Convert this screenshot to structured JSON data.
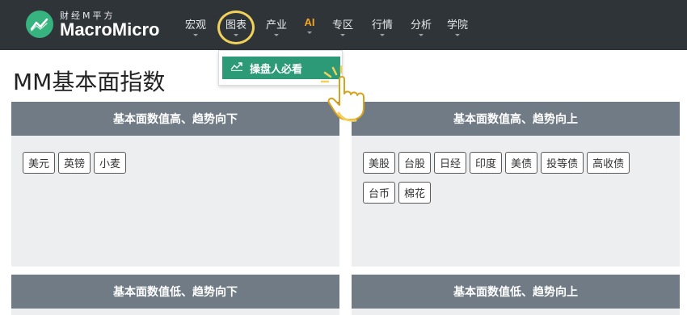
{
  "nav": {
    "logo_small": "财经M平方",
    "logo_big": "MacroMicro",
    "items": [
      {
        "label": "宏观"
      },
      {
        "label": "图表"
      },
      {
        "label": "产业"
      },
      {
        "label": "AI"
      },
      {
        "label": "专区"
      },
      {
        "label": "行情"
      },
      {
        "label": "分析"
      },
      {
        "label": "学院"
      }
    ]
  },
  "dropdown": {
    "item": "操盘人必看"
  },
  "page": {
    "title": "MM基本面指数"
  },
  "panels": [
    {
      "header": "基本面数值高、趋势向下",
      "tags": [
        "美元",
        "英镑",
        "小麦"
      ]
    },
    {
      "header": "基本面数值高、趋势向上",
      "tags": [
        "美股",
        "台股",
        "日经",
        "印度",
        "美债",
        "投等债",
        "高收债",
        "台币",
        "棉花"
      ]
    },
    {
      "header": "基本面数值低、趋势向下",
      "tags": []
    },
    {
      "header": "基本面数值低、趋势向上",
      "tags": []
    }
  ],
  "colors": {
    "navbar": "#2e3438",
    "accent": "#2c9a77",
    "logo": "#36b37e",
    "ai": "#f5a623",
    "highlight": "#f2d15a",
    "panel_header": "#707b86",
    "panel_body": "#eceef0"
  }
}
